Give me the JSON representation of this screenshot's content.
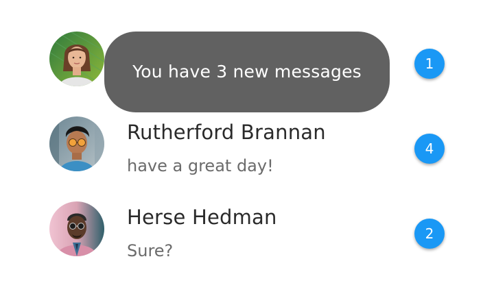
{
  "toast": {
    "text": "You have 3 new messages"
  },
  "conversations": [
    {
      "name": "",
      "message": "",
      "unread": "1",
      "avatar_icon": "person-photo-icon"
    },
    {
      "name": "Rutherford Brannan",
      "message": "have a great day!",
      "unread": "4",
      "avatar_icon": "person-photo-icon"
    },
    {
      "name": "Herse Hedman",
      "message": "Sure?",
      "unread": "2",
      "avatar_icon": "person-photo-icon"
    }
  ],
  "colors": {
    "badge": "#1a98f5",
    "toast_background": "#616161",
    "name_text": "#2a2a2a",
    "message_text": "#6b6b6b"
  }
}
